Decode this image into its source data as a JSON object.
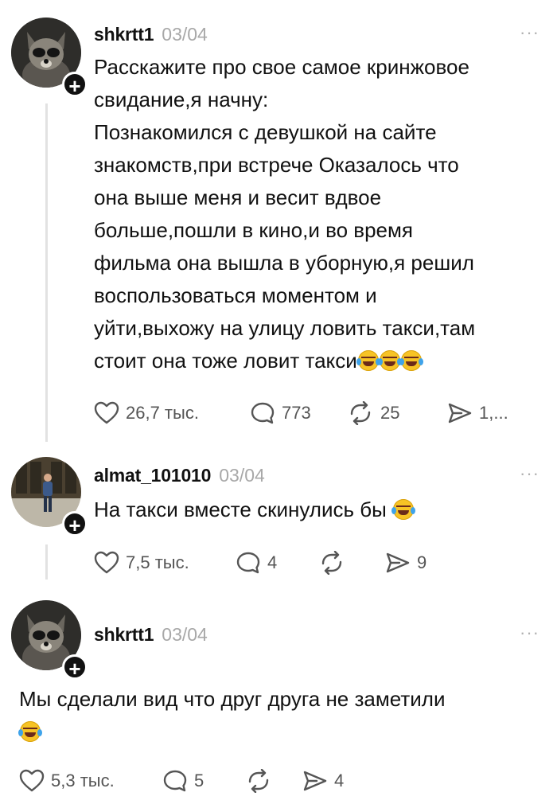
{
  "posts": [
    {
      "username": "shkrtt1",
      "date": "03/04",
      "more": "···",
      "text_lines": [
        "Расскажите про свое самое кринжовое",
        "свидание,я начну:",
        "Познакомился с девушкой на сайте",
        "знакомств,при встрече Оказалось что",
        "она выше меня и весит вдвое",
        "больше,пошли в кино,и во время",
        "фильма она вышла в уборную,я решил",
        "воспользоваться моментом и",
        "уйти,выхожу на улицу ловить такси,там",
        "стоит она тоже ловит такси"
      ],
      "likes": "26,7 тыс.",
      "comments": "773",
      "reposts": "25",
      "shares": "1,..."
    },
    {
      "username": "almat_101010",
      "date": "03/04",
      "more": "···",
      "text_lines": [
        "На такси вместе скинулись бы"
      ],
      "likes": "7,5 тыс.",
      "comments": "4",
      "reposts": "",
      "shares": "9"
    },
    {
      "username": "shkrtt1",
      "date": "03/04",
      "more": "···",
      "text_lines": [
        "Мы сделали вид что друг друга не заметили"
      ],
      "likes": "5,3 тыс.",
      "comments": "5",
      "reposts": "",
      "shares": "4"
    }
  ],
  "icons": {
    "like": "heart-icon",
    "comment": "comment-bubble-icon",
    "repost": "repost-icon",
    "share": "send-icon",
    "follow": "plus-icon",
    "emoji": "rolling-laughing-emoji"
  },
  "colors": {
    "text": "#111111",
    "muted": "#a8a8a8",
    "icon": "#555555"
  }
}
